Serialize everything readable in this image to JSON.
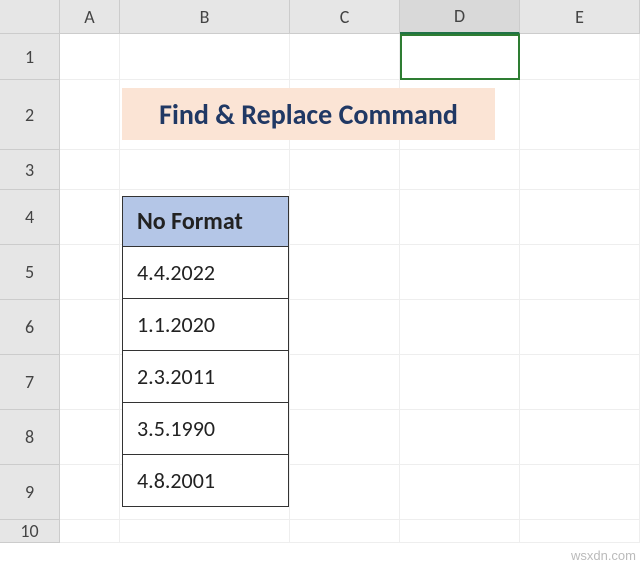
{
  "columns": [
    "A",
    "B",
    "C",
    "D",
    "E"
  ],
  "rows": [
    "1",
    "2",
    "3",
    "4",
    "5",
    "6",
    "7",
    "8",
    "9",
    "10"
  ],
  "selected_column": "D",
  "selected_cell": "D1",
  "title": "Find & Replace Command",
  "table": {
    "header": "No Format",
    "values": [
      "4.4.2022",
      "1.1.2020",
      "2.3.2011",
      "3.5.1990",
      "4.8.2001"
    ]
  },
  "watermark": "wsxdn.com",
  "chart_data": {
    "type": "table",
    "title": "Find & Replace Command",
    "columns": [
      "No Format"
    ],
    "rows": [
      [
        "4.4.2022"
      ],
      [
        "1.1.2020"
      ],
      [
        "2.3.2011"
      ],
      [
        "3.5.1990"
      ],
      [
        "4.8.2001"
      ]
    ]
  }
}
